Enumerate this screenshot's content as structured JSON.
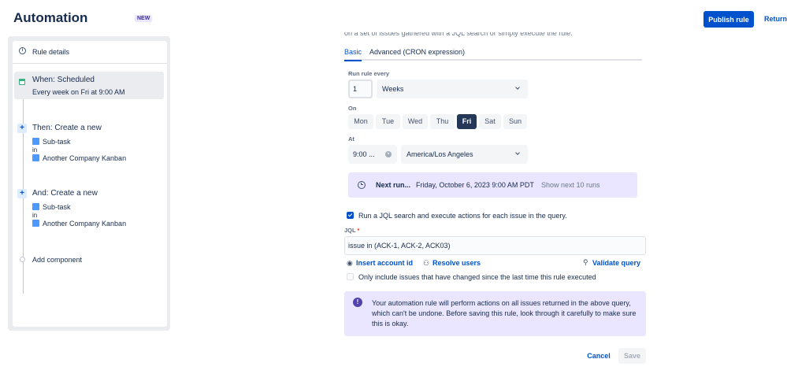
{
  "header": {
    "title": "Automation",
    "badge": "NEW",
    "publish_label": "Publish rule",
    "return_label": "Return"
  },
  "sidebar": {
    "rule_details": "Rule details",
    "trigger": {
      "title": "When: Scheduled",
      "subtitle": "Every week on Fri at 9:00 AM"
    },
    "actions": [
      {
        "title": "Then: Create a new",
        "issue_type": "Sub-task",
        "in": "in",
        "project": "Another Company Kanban"
      },
      {
        "title": "And: Create a new",
        "issue_type": "Sub-task",
        "in": "in",
        "project": "Another Company Kanban"
      }
    ],
    "add_component": "Add component"
  },
  "main": {
    "cut_text": "on a set of issues gathered with a JQL search or simply execute the rule.",
    "tabs": [
      "Basic",
      "Advanced (CRON expression)"
    ],
    "run_every_label": "Run rule every",
    "run_every_value": "1",
    "period": "Weeks",
    "on_label": "On",
    "days": [
      "Mon",
      "Tue",
      "Wed",
      "Thu",
      "Fri",
      "Sat",
      "Sun"
    ],
    "selected_day": "Fri",
    "at_label": "At",
    "time": "9:00 ...",
    "timezone": "America/Los Angeles",
    "next_run_label": "Next run...",
    "next_run_value": "Friday, October 6, 2023 9:00 AM PDT",
    "show_next": "Show next 10 runs",
    "jql_checkbox_label": "Run a JQL search and execute actions for each issue in the query.",
    "jql_label": "JQL",
    "jql_required": "*",
    "jql_value": "issue in (ACK-1, ACK-2, ACK03)",
    "insert_account": "Insert account id",
    "resolve_users": "Resolve users",
    "validate_query": "Validate query",
    "only_changed_label": "Only include issues that have changed since the last time this rule executed",
    "warning": "Your automation rule will perform actions on all issues returned in the above query, which can't be undone. Before saving this rule, look through it carefully to make sure this is okay.",
    "cancel_label": "Cancel",
    "save_label": "Save"
  }
}
